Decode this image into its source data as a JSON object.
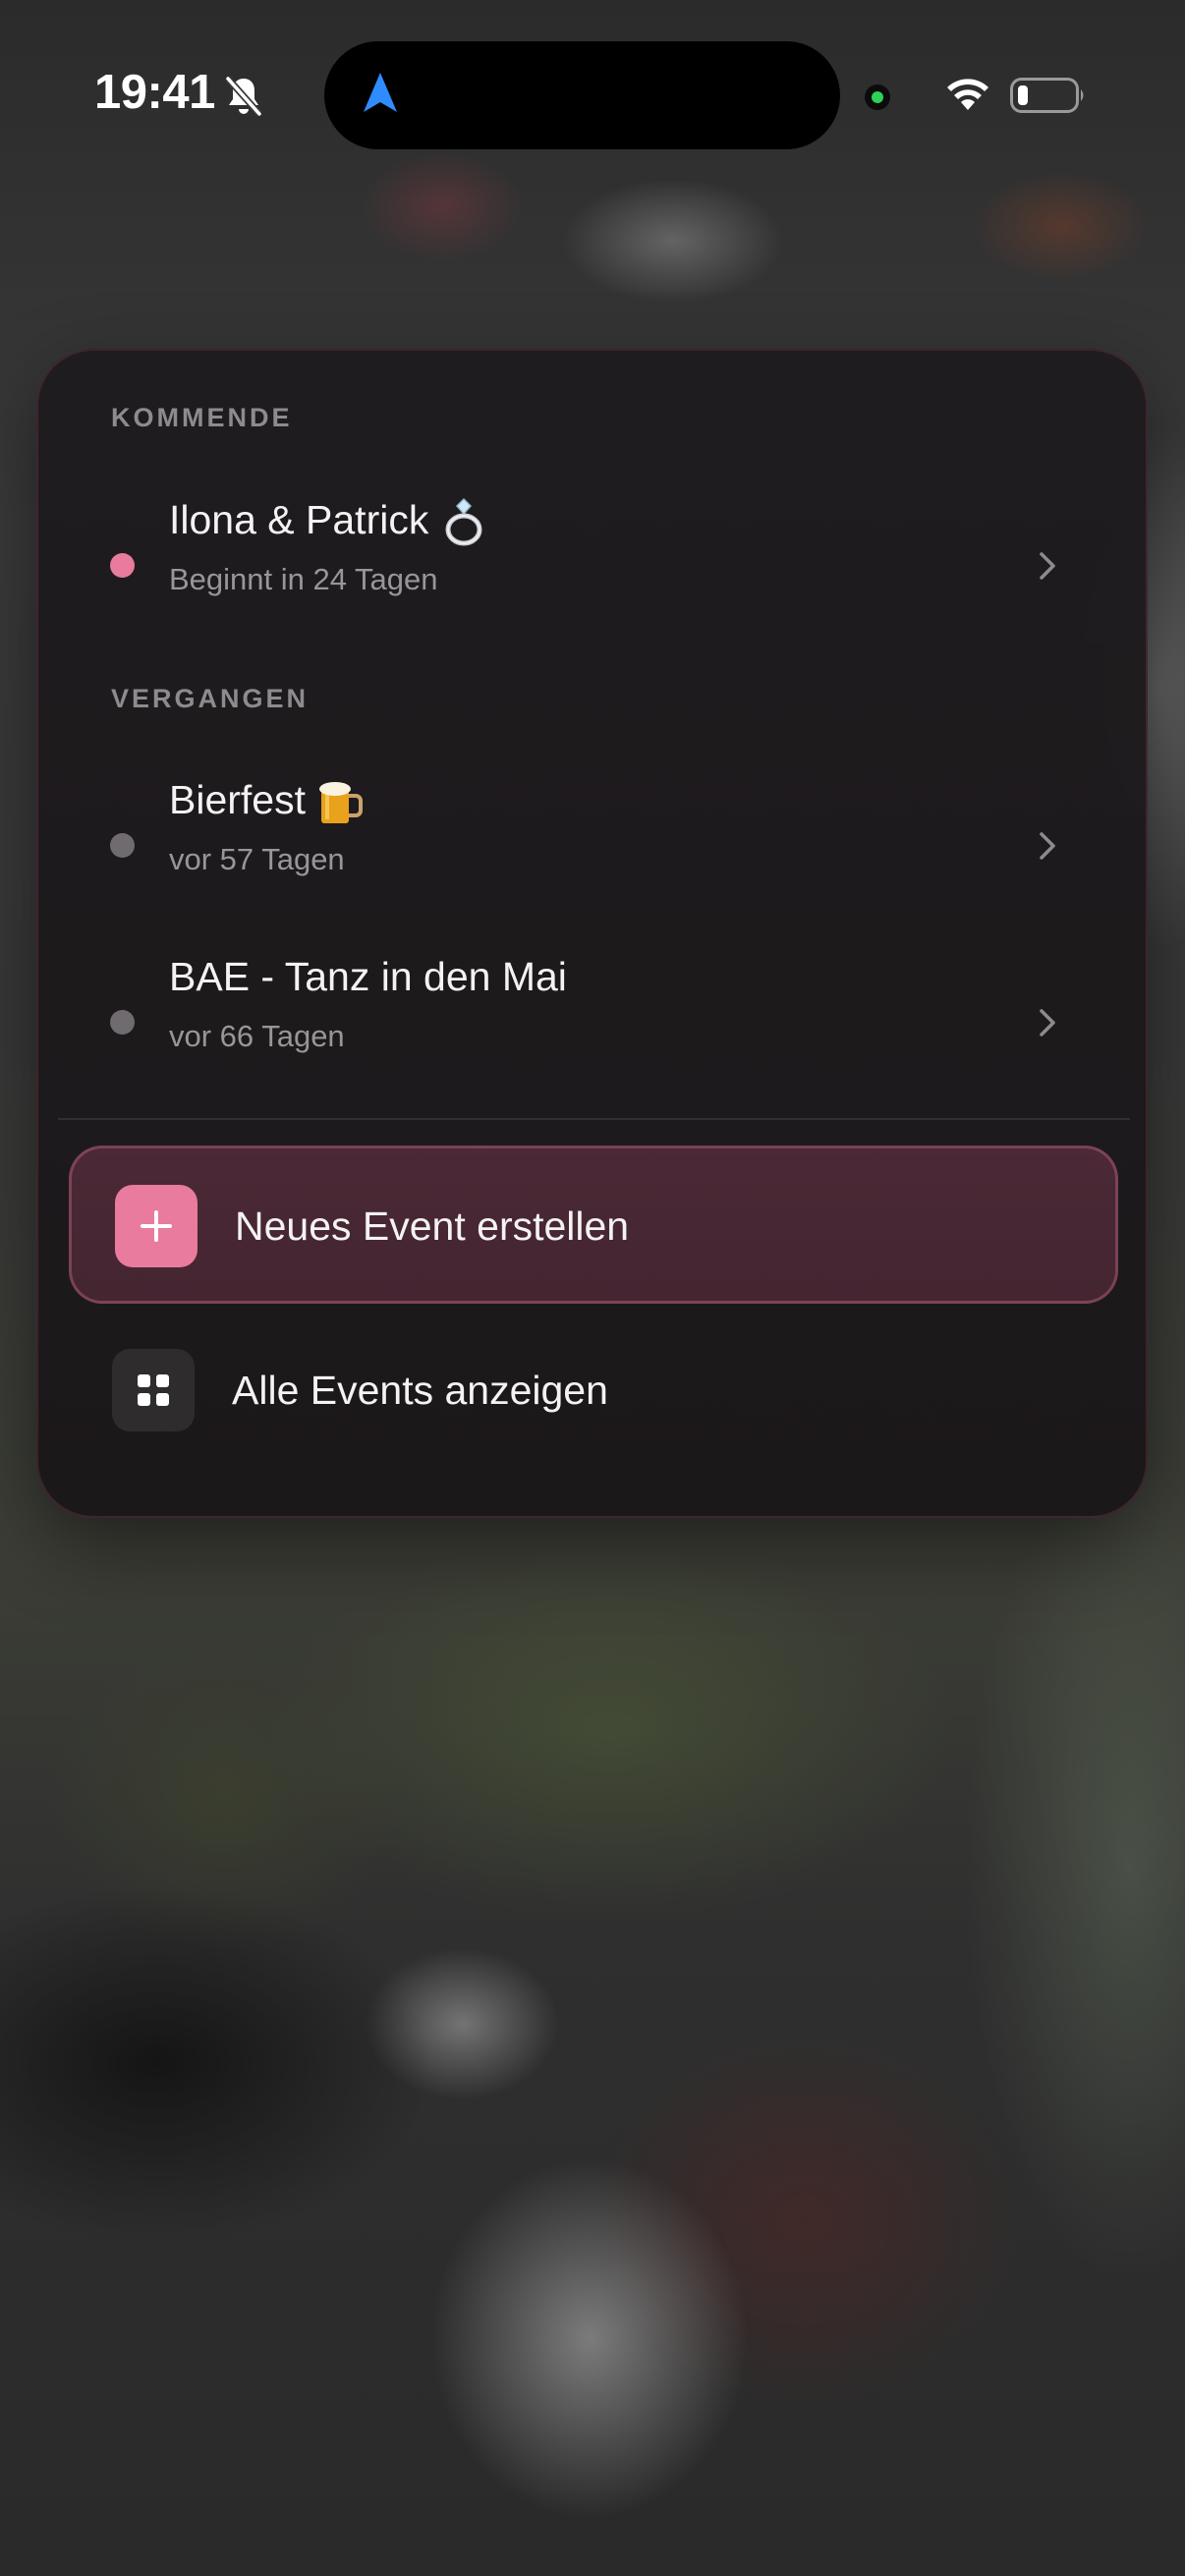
{
  "status_bar": {
    "time": "19:41",
    "icons": [
      "bell-slash-icon",
      "navigation-arrow-icon",
      "camera-active-dot-icon",
      "wifi-icon",
      "battery-icon"
    ],
    "battery_level": 0.15,
    "accent_colors": {
      "navigation_arrow": "#2f8cff",
      "active_dot": "#30d158"
    }
  },
  "menu": {
    "sections": {
      "upcoming_label": "KOMMENDE",
      "past_label": "VERGANGEN"
    },
    "upcoming_events": [
      {
        "title": "Ilona & Patrick",
        "emoji_icon": "ring-icon",
        "subtitle": "Beginnt in 24 Tagen",
        "dot_color": "#e87b9e"
      }
    ],
    "past_events": [
      {
        "title": "Bierfest",
        "emoji_icon": "beer-mug-icon",
        "subtitle": "vor 57 Tagen",
        "dot_color": "#6f6b6e"
      },
      {
        "title": "BAE - Tanz in den Mai",
        "subtitle": "vor 66 Tagen",
        "dot_color": "#6f6b6e"
      }
    ],
    "actions": {
      "create_label": "Neues Event erstellen",
      "create_icon": "plus-icon",
      "all_events_label": "Alle Events anzeigen",
      "all_events_icon": "grid-icon"
    },
    "colors": {
      "accent": "#e87b9e",
      "card_background": "#1d1a1c"
    }
  }
}
